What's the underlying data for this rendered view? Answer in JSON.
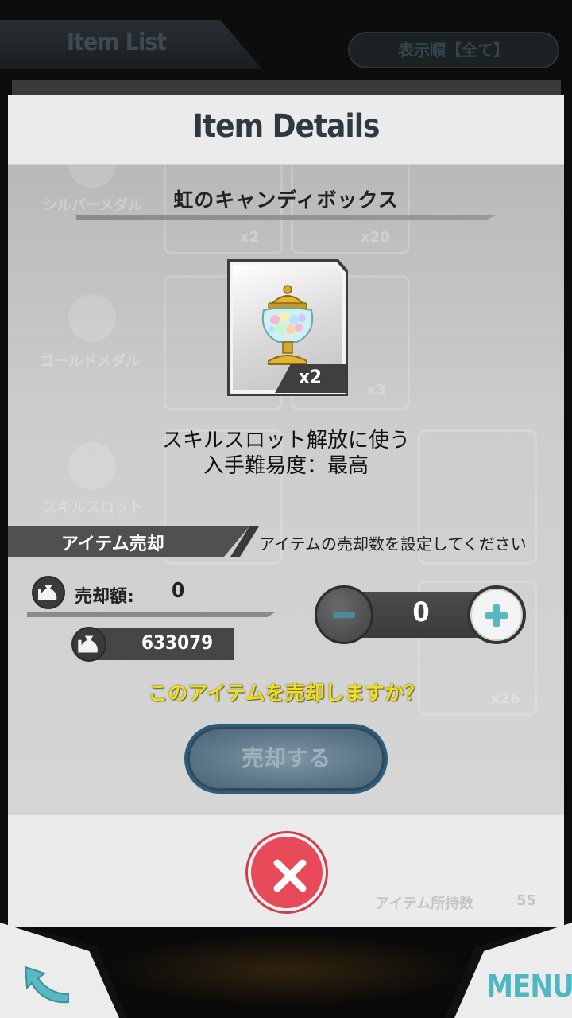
{
  "background": {
    "title": "Item List",
    "sort_button": "表示順【全て】",
    "ghost_items": [
      "シルバーメダル",
      "ゴールドメダル",
      "スキルスロット"
    ],
    "ghost_counts": [
      "x2",
      "x20",
      "x3",
      "x26"
    ],
    "owned_footer": "アイテム所持数",
    "owned_footer_count": "55"
  },
  "modal": {
    "title": "Item Details",
    "item_name": "虹のキャンディボックス",
    "item_count": "x2",
    "description_line1": "スキルスロット解放に使う",
    "description_line2": "入手難易度：最高",
    "sell_section_label": "アイテム売却",
    "sell_hint": "アイテムの売却数を設定してください",
    "sale_amount_label": "売却額:",
    "sale_amount_value": "0",
    "owned_money": "633079",
    "quantity": "0",
    "confirm_question": "このアイテムを売却しますか？",
    "sell_button": "売却する"
  },
  "nav": {
    "menu_label": "MENU"
  },
  "colors": {
    "accent_cyan": "#58b7c4",
    "confirm_yellow": "#f2e01b",
    "close_red": "#e94a5a"
  },
  "icons": [
    "back-arrow-icon",
    "money-bag-icon",
    "minus-icon",
    "plus-icon",
    "close-icon",
    "candy-jar-icon"
  ]
}
